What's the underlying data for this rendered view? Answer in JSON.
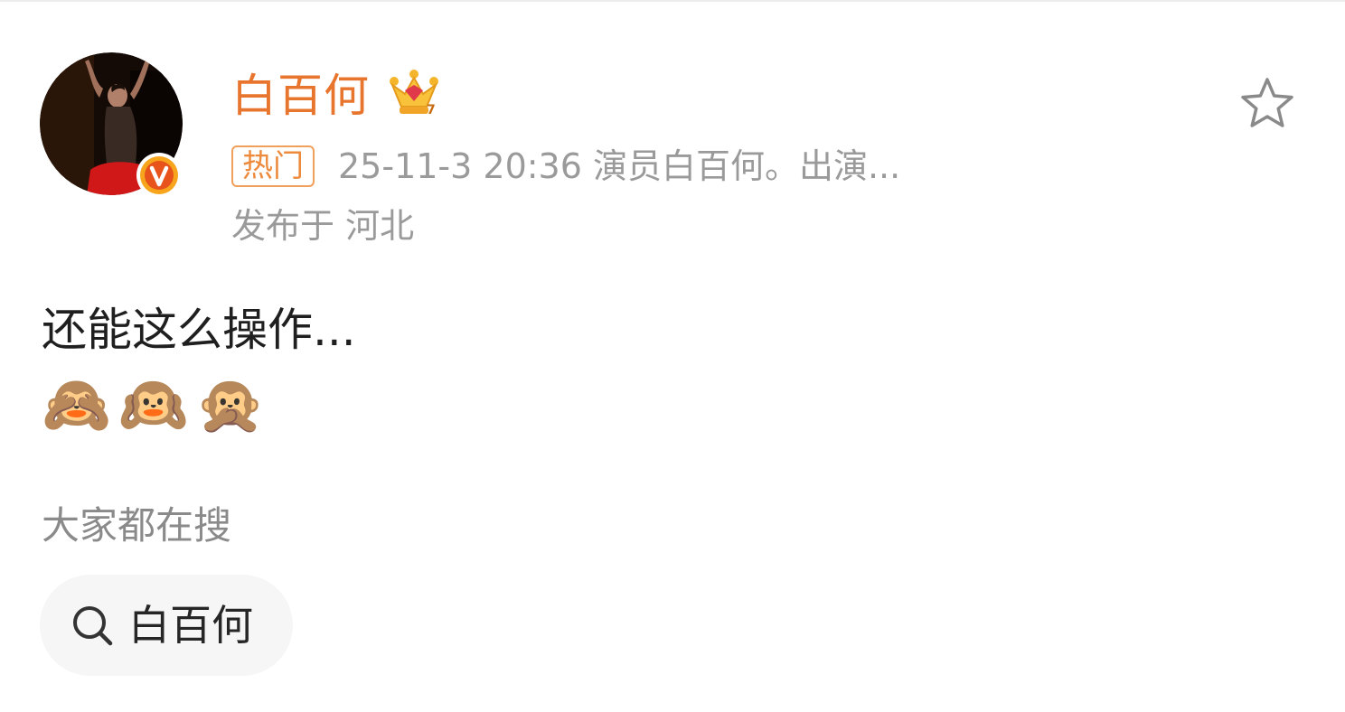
{
  "post": {
    "author": {
      "name": "白百何",
      "avatar_icon": "avatar-photo",
      "verified_icon": "verified-v-badge-icon",
      "level_icon": "crown-icon"
    },
    "hot_tag": "热门",
    "meta": "25-11-3 20:36  演员白百何。出演...",
    "location": "发布于 河北",
    "content": "还能这么操作...",
    "emoji": "🙈🙉🙊",
    "favorite_icon": "star-icon"
  },
  "search_section": {
    "heading": "大家都在搜",
    "chip": {
      "icon": "search-icon",
      "label": "白百何"
    }
  },
  "colors": {
    "accent": "#e8752d",
    "muted": "#9a9a9a",
    "text": "#1f1f1f",
    "chip_bg": "#f6f6f6"
  }
}
